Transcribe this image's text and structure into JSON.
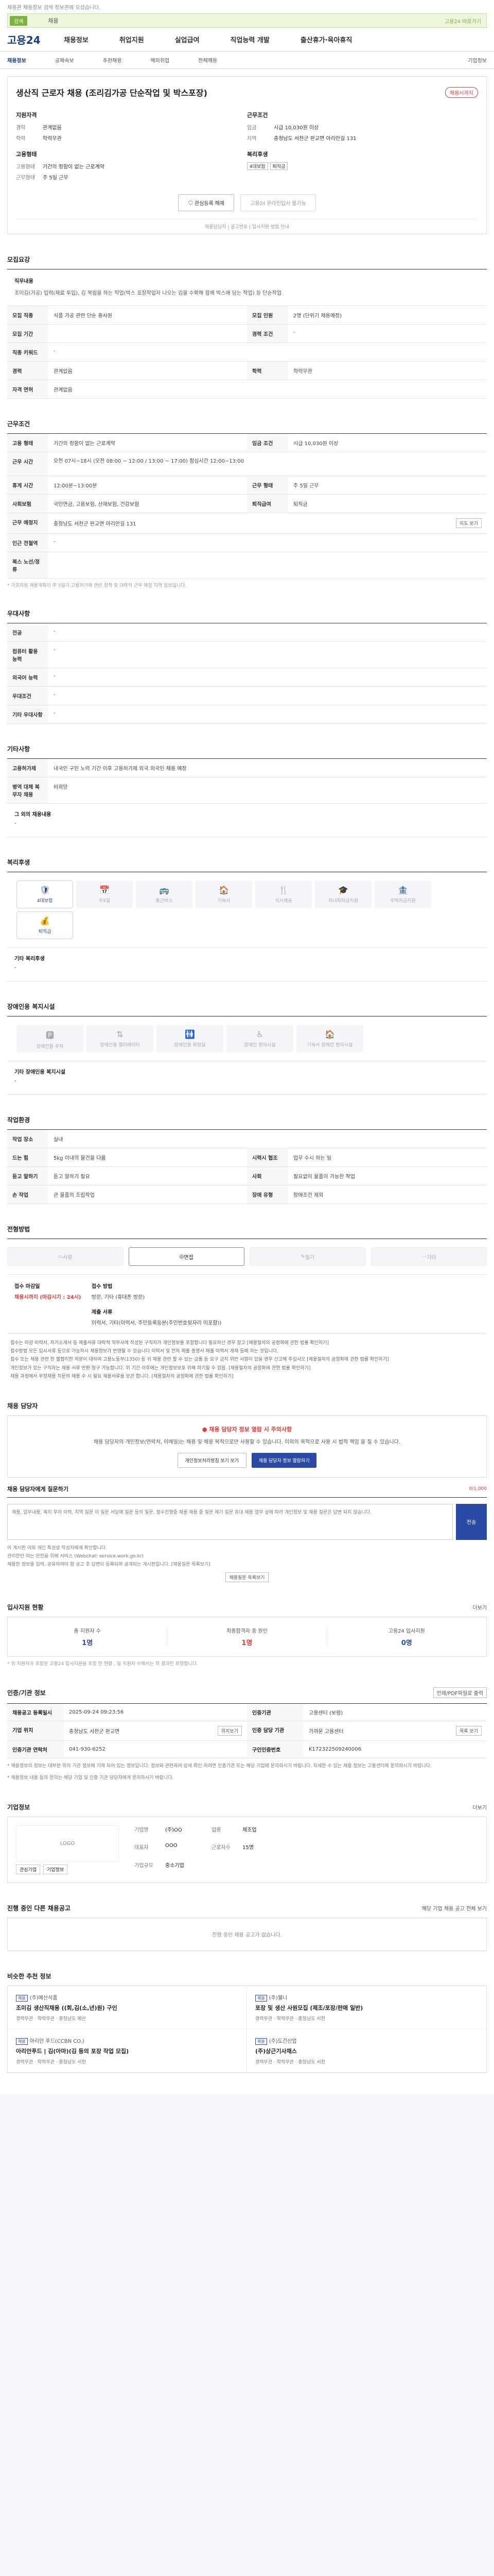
{
  "header": {
    "top_notice": "채용관 채용정보 검색 정보관에 오셨습니다.",
    "search_chip": "검색",
    "search_text": "채용",
    "search_right": "고용24 바로가기",
    "logo": "고용24",
    "gnb": [
      "채용정보",
      "취업지원",
      "실업급여",
      "직업능력 개발",
      "출산휴가·육아휴직"
    ],
    "subnav": [
      "채용정보",
      "공채속보",
      "추천채용",
      "해외취업",
      "전체채용",
      "기업정보"
    ]
  },
  "title": {
    "text": "생산직 근로자 채용 (조리김가공 단순작업 및 박스포장)",
    "badge": "채용시까지",
    "left_h": "지원자격",
    "left_rows": [
      {
        "k": "경력",
        "v": "관계없음"
      },
      {
        "k": "학력",
        "v": "학력무관"
      }
    ],
    "left_h2": "고용형태",
    "left_rows2": [
      {
        "k": "고용형태",
        "v": "기간의 정함이 없는 근로계약"
      },
      {
        "k": "근무형태",
        "v": "주 5일 근무"
      }
    ],
    "right_h": "근무조건",
    "right_rows": [
      {
        "k": "임금",
        "v": "시급 10,030원 이상"
      },
      {
        "k": "지역",
        "v": "충청남도 서천군 판교면 아리안길 131"
      }
    ],
    "right_h2": "복리후생",
    "right_tags": [
      "4대보험",
      "퇴직금"
    ],
    "btn_interest": "관심등록 해제",
    "btn_apply": "고용24 온라인입사 불가능",
    "apply_info": "채용담당자 | 공고번호 | 입사지원 방법 안내"
  },
  "recruit": {
    "h": "모집요강",
    "duty_h": "직무내용",
    "duty_t": "조미김(가공) 입력(재료 투입), 김 복림을 하는 작업(박스 포장작업자 나오는 김을 수확해 함께 박스에 담는 작업) 등 단순작업",
    "rows": [
      {
        "k1": "모집 직종",
        "v1": "식품 가공 관련 단순 종사원",
        "k2": "모집 인원",
        "v2": "2명 (단위기 채용예정)"
      },
      {
        "k1": "모집 기간",
        "v1": "",
        "k2": "경력 조건",
        "v2": "-"
      },
      {
        "k1": "직종 키워드",
        "v1": "-",
        "k2": "",
        "v2": ""
      },
      {
        "k1": "경력",
        "v1": "관계없음",
        "k2": "학력",
        "v2": "학력무관"
      },
      {
        "k1": "자격 면허",
        "v1": "관계없음",
        "k2": "",
        "v2": ""
      }
    ]
  },
  "conditions": {
    "h": "근무조건",
    "rows": [
      {
        "k1": "고용 형태",
        "v1": "기간의 정함이 없는 근로계약",
        "k2": "임금 조건",
        "v2": "시급 10,030원 이상"
      },
      {
        "k1": "근무 시간",
        "v1": "오전 07시~18시 (오전 08:00 ~ 12:00 / 13:00 ~ 17:00) 점심시간 12:00~13:00",
        "k2": "",
        "v2": ""
      },
      {
        "k1": "휴게 시간",
        "v1": "12:00분~13:00분",
        "k2": "근무 형태",
        "v2": "주 5일 근무"
      },
      {
        "k1": "사회보험",
        "v1": "국민연금, 고용보험, 산재보험, 건강보험",
        "k2": "퇴직급여",
        "v2": "퇴직금"
      },
      {
        "k1": "근무 예정지",
        "v1": "충청남도 서천군 판교면 아리안길 131",
        "k2": "",
        "v2": ""
      },
      {
        "k1": "인근 전철역",
        "v1": "-",
        "k2": "",
        "v2": ""
      },
      {
        "k1": "복스 노선/정류",
        "v1": "",
        "k2": "",
        "v2": ""
      }
    ],
    "note": "* 기초지원 채용계획이 주 5일기 고용허가제 관련 정책 및 대략적 근무 예정 지역 정보입니다.",
    "map_btn": "지도 보기"
  },
  "prefer": {
    "h": "우대사항",
    "rows": [
      {
        "k": "전공",
        "v": "-"
      },
      {
        "k": "컴퓨터 활용 능력",
        "v": "-"
      },
      {
        "k": "외국어 능력",
        "v": "-"
      },
      {
        "k": "우대조건",
        "v": "-"
      },
      {
        "k": "기타 우대사항",
        "v": "-"
      }
    ]
  },
  "other": {
    "h": "기타사항",
    "rows": [
      {
        "k": "고용허가제",
        "v": "내국인 구인 노력 기간 이후 고용허가제 외국 외국인 채용 예정"
      },
      {
        "k": "병역 대체 복무자 채용",
        "v": "비희망"
      }
    ],
    "etc_h": "그 외의 채용내용",
    "etc_v": "-"
  },
  "welfare": {
    "h": "복리후생",
    "tiles": [
      {
        "name": "4대보험",
        "icon": "🛡",
        "on": true
      },
      {
        "name": "주5일",
        "icon": "📅",
        "on": false
      },
      {
        "name": "통근버스",
        "icon": "🚌",
        "on": false
      },
      {
        "name": "기숙사",
        "icon": "🏠",
        "on": false
      },
      {
        "name": "식사제공",
        "icon": "🍴",
        "on": false
      },
      {
        "name": "자녀학자금지원",
        "icon": "🎓",
        "on": false
      },
      {
        "name": "주택자금지원",
        "icon": "🏦",
        "on": false
      },
      {
        "name": "퇴직금",
        "icon": "💰",
        "on": true
      }
    ],
    "sub_h": "기타 복리후생",
    "sub_v": "-"
  },
  "disability": {
    "h": "장애인용 복지시설",
    "tiles": [
      {
        "name": "장애인용 주차",
        "icon": "🅿"
      },
      {
        "name": "장애인용 엘리베이터",
        "icon": "⇅"
      },
      {
        "name": "장애인용 화장실",
        "icon": "🚻"
      },
      {
        "name": "장애인 편의시설",
        "icon": "♿"
      },
      {
        "name": "기숙사 장애인 편의시설",
        "icon": "🏠"
      }
    ],
    "sub_h": "기타 장애인용 복지시설",
    "sub_v": "-"
  },
  "job_env": {
    "h": "작업환경",
    "rows": [
      {
        "k1": "작업 장소",
        "v1": "실내",
        "k2": "",
        "v2": ""
      },
      {
        "k1": "드는 힘",
        "v1": "5kg 이내의 물건을 다룸",
        "k2": "시력시 협조",
        "v2": "업무 수시 하는 일"
      },
      {
        "k1": "듣고 말하기",
        "v1": "듣고 말하기 필요",
        "k2": "사회",
        "v2": "필요없이 물품이 가능한 작업"
      },
      {
        "k1": "손 작업",
        "v1": "큰 물품의 조립작업",
        "k2": "장애 유형",
        "v2": "장애조건 제외"
      }
    ]
  },
  "process": {
    "h": "전형방법",
    "steps": [
      {
        "name": "서류",
        "on": false
      },
      {
        "name": "면접",
        "on": true
      },
      {
        "name": "필기",
        "on": false
      },
      {
        "name": "기타",
        "on": false
      }
    ],
    "apply_h": "접수 마감일",
    "apply_v": "채용시까지 (마감시기 : 24시)",
    "method_h": "접수 방법",
    "method_v": "방문, 기타 (휴대폰 방문)",
    "docs_h": "제출 서류",
    "docs_v": "이력서, 기타(이력서, 주민등록등본(주민번호뒷자리 미포함))",
    "bullets": [
      "접수는 마감 이력서, 자기소개서 등 제출서류 대략적 직무사례 작성된 구직자가 개인정보를 포함합니다 필요하신 경우 참고 [채용절차의 공정화에 관한 법률 확인하기]",
      "접수방법 모든 입사서류 등으로 가능하시 채용정보가 반영될 수 있습니다 이력서 및 전자 제출 증명서 제출 이력서 게재 등에 하는 것입니다.",
      "접수 또는 채용 관련 한 불합리한 처분이 대하여 고용노동부(1350) 등 귀 채용 관련 할 수 있는 금품 등 요구 금지 위반 사항이 있을 경우 신고해 주십시오 [채용절차의 공정화에 관한 법률 확인하기]",
      "개인정보가 있는 구직자는 채용 서류 반환 청구 가능합니다. 위 기간 이후에는 개인정보보호 위해 파기될 수 있음. [채용절차의 공정화에 관한 법률 확인하기]",
      "채용 과정에서 부정채용 지문의 채용 수 시 필요 채용서류를 보관 합니다. [채용절차의 공정화에 관한 법률 확인하기]"
    ]
  },
  "qa": {
    "h": "채용 담당자",
    "warn_h": "채용 담당자 정보 열람 시 주의사항",
    "warn_t": "채용 담당자의 개인정보(연락처, 이메일)는 채용 및 채용 목적으로만 사용할 수 있습니다. 이외의 목적으로 사용 시 법적 책임 을 질 수 있습니다.",
    "btn_left": "개인정보처리방침 보기 보기",
    "btn_right": "채용 담당자 정보 열람하기",
    "ask_h": "채용 담당자에게 질문하기",
    "ask_cnt": "0/1,000",
    "placeholder": "채용, 업무내용, 복리 우리 이력, 지역 질문 이 질문 서당에 질문 등의 질문, 접수진행중 채용 채용 중 질문 제기 질문 휴대 채용 업무 상에 따라 개인정보 및 채용 질문은 답변 되지 않습니다.",
    "submit": "전송",
    "bullets": [
      "이 게시판 이외 개인 특성상 작성자에게 확인합니다.",
      "관리한만 하는 안전을 위해 서비스 (Webchat: service.work.go.kr)",
      "채용한 정보를 입력, 공유하여야 할 공고 후 답변이 등록되며 공개되는 게시판입니다. [채용질문 목록보기]"
    ],
    "list_btn": "채용질문 목록보기"
  },
  "applicant": {
    "h": "입사지원 현황",
    "more": "더보기",
    "stats": [
      {
        "label": "총 지원자 수",
        "value": "1명",
        "red": false
      },
      {
        "label": "최종합격자 중 원인",
        "value": "1명",
        "red": true
      },
      {
        "label": "고용24 입사지원",
        "value": "0명",
        "red": false
      }
    ],
    "note": "* 위 지원자가 포함된 고용24 입사지원을 포함 한 현황 , 일 지원자 수에서는 위 결과만 포함합니다."
  },
  "info": {
    "h": "인증/기관 정보",
    "print_btn": "인쇄/PDF파일로 출력",
    "cells": [
      {
        "k": "채용공고 등록일시",
        "v": "2025-09-24 09:23:56"
      },
      {
        "k": "인증기관",
        "v": "고용센터 (보령)"
      },
      {
        "k": "기업 위치",
        "v": "충청남도 서천군 판교면"
      },
      {
        "k": "인증 담당 기관",
        "v": "가까운 고용센터"
      },
      {
        "k": "인증기관 연락처",
        "v": "041-930-6252"
      },
      {
        "k": "구인인증번호",
        "v": "K172322509240006"
      }
    ],
    "btn_map": "위치보기",
    "btn_list": "목록 보기",
    "note": "* 채용정보의 정보는 대부분 위의 기관 정보에 기재 되어 있는 정보입니다. 정보와 관련하여 상세 확인 하려면 인증기관 또는 해당 기업에 문의하시기 바랍니다. 자세한 수 있는 채용 정보는 고용센터에 문의하시기 바랍니다.",
    "note2": "* 채용정보 내용 등의 문의는 해당 기업 및 인증 기관 담당자에게 문의하시기 바랍니다."
  },
  "company": {
    "h": "기업정보",
    "more": "더보기",
    "logo_text": "LOGO",
    "btns": [
      "관심기업",
      "기업정보"
    ],
    "info": [
      {
        "k": "기업명",
        "v": "(주)OO"
      },
      {
        "k": "업종",
        "v": "제조업"
      },
      {
        "k": "대표자",
        "v": "OOO"
      },
      {
        "k": "근로자수",
        "v": "15명"
      },
      {
        "k": "기업규모",
        "v": "중소기업"
      },
      {
        "k": "",
        "v": ""
      }
    ]
  },
  "other_jobs": {
    "h": "진행 중인 다른 채용공고",
    "more": "해당 기업 채용 공고 전체 보기",
    "empty": "진행 중인 채용 공고가 없습니다."
  },
  "recommend": {
    "h": "비슷한 추천 정보",
    "items": [
      {
        "tag": "채용",
        "comp": "(주)예산식품",
        "title": "조미김 생산직채용 ((회,김(소,년)원) 구인",
        "meta": "경력무관 · 학력무관 · 충청남도 예산"
      },
      {
        "tag": "채용",
        "comp": "(주)웰니",
        "title": "포장 및 생산 사원모집 (제조/포장/판매 일반)",
        "meta": "경력무관 · 학력무관 · 충청남도 서천"
      },
      {
        "tag": "채용",
        "comp": "아리안 푸드(CCBN CO.)",
        "title": "아리안푸드 | 김(아마)(김 등의 포장 작업 모집)",
        "meta": "경력무관 · 학력무관 · 충청남도 서천"
      },
      {
        "tag": "채용",
        "comp": "(주)도건산업",
        "title": "(주)상근기사채스",
        "meta": "경력무관 · 학력무관 · 충청남도 서천"
      }
    ]
  }
}
